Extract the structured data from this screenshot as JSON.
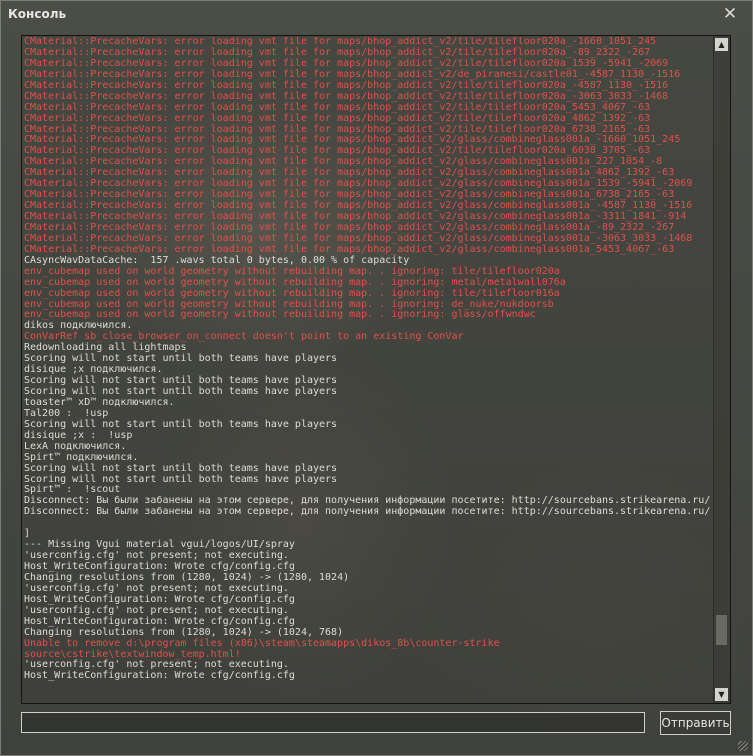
{
  "window": {
    "title": "Консоль",
    "close_icon": "close-icon"
  },
  "log": [
    {
      "text": "CMaterial::PrecacheVars: error loading vmt file for maps/bhop_addict_v2/tile/tilefloor020a_-1660_1051_245",
      "type": "error"
    },
    {
      "text": "CMaterial::PrecacheVars: error loading vmt file for maps/bhop_addict_v2/tile/tilefloor020a_-89_2322_-267",
      "type": "error"
    },
    {
      "text": "CMaterial::PrecacheVars: error loading vmt file for maps/bhop_addict_v2/tile/tilefloor020a_1539_-5941_-2069",
      "type": "error"
    },
    {
      "text": "CMaterial::PrecacheVars: error loading vmt file for maps/bhop_addict_v2/de_piranesi/castle01_-4587_1130_-1516",
      "type": "error"
    },
    {
      "text": "CMaterial::PrecacheVars: error loading vmt file for maps/bhop_addict_v2/tile/tilefloor020a_-4587_1130_-1516",
      "type": "error"
    },
    {
      "text": "CMaterial::PrecacheVars: error loading vmt file for maps/bhop_addict_v2/tile/tilefloor020a_-3063_3033_-1468",
      "type": "error"
    },
    {
      "text": "CMaterial::PrecacheVars: error loading vmt file for maps/bhop_addict_v2/tile/tilefloor020a_5453_4067_-63",
      "type": "error"
    },
    {
      "text": "CMaterial::PrecacheVars: error loading vmt file for maps/bhop_addict_v2/tile/tilefloor020a_4862_1392_-63",
      "type": "error"
    },
    {
      "text": "CMaterial::PrecacheVars: error loading vmt file for maps/bhop_addict_v2/tile/tilefloor020a_6738_2165_-63",
      "type": "error"
    },
    {
      "text": "CMaterial::PrecacheVars: error loading vmt file for maps/bhop_addict_v2/glass/combineglass001a_-1660_1051_245",
      "type": "error"
    },
    {
      "text": "CMaterial::PrecacheVars: error loading vmt file for maps/bhop_addict_v2/tile/tilefloor020a_6038_3705_-63",
      "type": "error"
    },
    {
      "text": "CMaterial::PrecacheVars: error loading vmt file for maps/bhop_addict_v2/glass/combineglass001a_227_1054_-8",
      "type": "error"
    },
    {
      "text": "CMaterial::PrecacheVars: error loading vmt file for maps/bhop_addict_v2/glass/combineglass001a_4862_1392_-63",
      "type": "error"
    },
    {
      "text": "CMaterial::PrecacheVars: error loading vmt file for maps/bhop_addict_v2/glass/combineglass001a_1539_-5941_-2069",
      "type": "error"
    },
    {
      "text": "CMaterial::PrecacheVars: error loading vmt file for maps/bhop_addict_v2/glass/combineglass001a_6738_2165_-63",
      "type": "error"
    },
    {
      "text": "CMaterial::PrecacheVars: error loading vmt file for maps/bhop_addict_v2/glass/combineglass001a_-4587_1130_-1516",
      "type": "error"
    },
    {
      "text": "CMaterial::PrecacheVars: error loading vmt file for maps/bhop_addict_v2/glass/combineglass001a_-3311_1841_-914",
      "type": "error"
    },
    {
      "text": "CMaterial::PrecacheVars: error loading vmt file for maps/bhop_addict_v2/glass/combineglass001a_-89_2322_-267",
      "type": "error"
    },
    {
      "text": "CMaterial::PrecacheVars: error loading vmt file for maps/bhop_addict_v2/glass/combineglass001a_-3063_3033_-1468",
      "type": "error"
    },
    {
      "text": "CMaterial::PrecacheVars: error loading vmt file for maps/bhop_addict_v2/glass/combineglass001a_5453_4067_-63",
      "type": "error"
    },
    {
      "text": "CAsyncWavDataCache:  157 .wavs total 0 bytes, 0.00 % of capacity",
      "type": "normal"
    },
    {
      "text": "env_cubemap used on world geometry without rebuilding map. . ignoring: tile/tilefloor020a",
      "type": "error"
    },
    {
      "text": "env_cubemap used on world geometry without rebuilding map. . ignoring: metal/metalwall076a",
      "type": "error"
    },
    {
      "text": "env_cubemap used on world geometry without rebuilding map. . ignoring: tile/tilefloor016a",
      "type": "error"
    },
    {
      "text": "env_cubemap used on world geometry without rebuilding map. . ignoring: de_nuke/nukdoorsb",
      "type": "error"
    },
    {
      "text": "env_cubemap used on world geometry without rebuilding map. . ignoring: glass/offwndwc",
      "type": "error"
    },
    {
      "text": "dikos подключился.",
      "type": "normal"
    },
    {
      "text": "ConVarRef sb_close_browser_on_connect doesn't point to an existing ConVar",
      "type": "error"
    },
    {
      "text": "Redownloading all lightmaps",
      "type": "normal"
    },
    {
      "text": "Scoring will not start until both teams have players",
      "type": "normal"
    },
    {
      "text": "disique ;x подключился.",
      "type": "normal"
    },
    {
      "text": "Scoring will not start until both teams have players",
      "type": "normal"
    },
    {
      "text": "Scoring will not start until both teams have players",
      "type": "normal"
    },
    {
      "text": "toaster™ xD™ подключился.",
      "type": "normal"
    },
    {
      "text": "Tal200 :  !usp",
      "type": "normal"
    },
    {
      "text": "Scoring will not start until both teams have players",
      "type": "normal"
    },
    {
      "text": "disique ;x :  !usp",
      "type": "normal"
    },
    {
      "text": "LexA подключился.",
      "type": "normal"
    },
    {
      "text": "Spirt™ подключился.",
      "type": "normal"
    },
    {
      "text": "Scoring will not start until both teams have players",
      "type": "normal"
    },
    {
      "text": "Scoring will not start until both teams have players",
      "type": "normal"
    },
    {
      "text": "Spirt™ :  !scout",
      "type": "normal"
    },
    {
      "text": "Disconnect: Вы были забанены на этом сервере, для получения информации посетите: http://sourcebans.strikearena.ru/.",
      "type": "normal"
    },
    {
      "text": "Disconnect: Вы были забанены на этом сервере, для получения информации посетите: http://sourcebans.strikearena.ru/.",
      "type": "normal"
    },
    {
      "text": "",
      "type": "normal"
    },
    {
      "text": "]",
      "type": "normal"
    },
    {
      "text": "--- Missing Vgui material vgui/logos/UI/spray",
      "type": "normal"
    },
    {
      "text": "'userconfig.cfg' not present; not executing.",
      "type": "normal"
    },
    {
      "text": "Host_WriteConfiguration: Wrote cfg/config.cfg",
      "type": "normal"
    },
    {
      "text": "Changing resolutions from (1280, 1024) -> (1280, 1024)",
      "type": "normal"
    },
    {
      "text": "'userconfig.cfg' not present; not executing.",
      "type": "normal"
    },
    {
      "text": "Host_WriteConfiguration: Wrote cfg/config.cfg",
      "type": "normal"
    },
    {
      "text": "'userconfig.cfg' not present; not executing.",
      "type": "normal"
    },
    {
      "text": "Host_WriteConfiguration: Wrote cfg/config.cfg",
      "type": "normal"
    },
    {
      "text": "Changing resolutions from (1280, 1024) -> (1024, 768)",
      "type": "normal"
    },
    {
      "text": "Unable to remove d:\\program files (x86)\\steam\\steamapps\\dikos_8b\\counter-strike",
      "type": "error"
    },
    {
      "text": "source\\cstrike\\textwindow_temp.html!",
      "type": "error"
    },
    {
      "text": "'userconfig.cfg' not present; not executing.",
      "type": "normal"
    },
    {
      "text": "Host_WriteConfiguration: Wrote cfg/config.cfg",
      "type": "normal"
    }
  ],
  "input": {
    "value": "",
    "placeholder": ""
  },
  "submit_label": "Отправить",
  "scrollbar": {
    "up_icon": "scroll-up-arrow-icon",
    "down_icon": "scroll-down-arrow-icon"
  }
}
